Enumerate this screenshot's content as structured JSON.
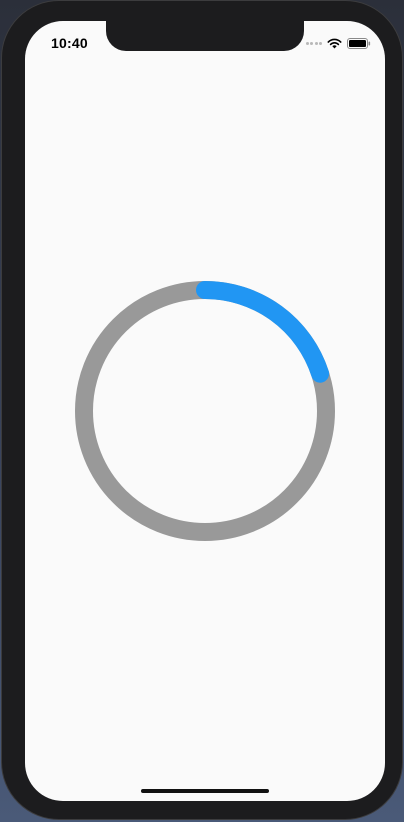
{
  "status_bar": {
    "time": "10:40",
    "icons": [
      "cellular-signal-icon",
      "wifi-icon",
      "battery-icon"
    ]
  },
  "progress_ring": {
    "progress": 0.2,
    "track_color": "#999999",
    "progress_color": "#2196f3",
    "background_color": "#fafafa"
  }
}
